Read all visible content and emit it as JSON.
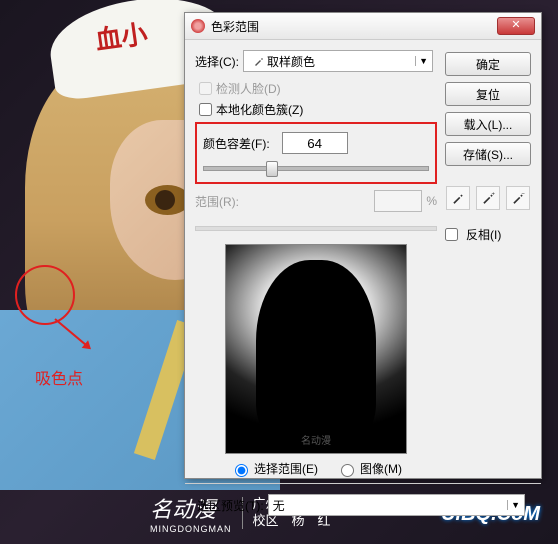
{
  "background": {
    "hat_text": "血小",
    "annotation": "吸色点",
    "logo_mark": "名动漫",
    "logo_sub": "MINGDONGMAN",
    "logo_line1": "广州　角　色",
    "logo_line2": "校区　杨　红",
    "watermark": "UiBQ.CoM"
  },
  "dialog": {
    "title": "色彩范围",
    "select_label": "选择(C):",
    "select_value": "取样颜色",
    "detect_faces": "检测人脸(D)",
    "localized": "本地化颜色簇(Z)",
    "fuzziness_label": "颜色容差(F):",
    "fuzziness_value": "64",
    "range_label": "范围(R):",
    "range_unit": "%",
    "radio_selection": "选择范围(E)",
    "radio_image": "图像(M)",
    "preview_wm": "名动漫",
    "footer_label": "选区预览(T):",
    "footer_value": "无"
  },
  "buttons": {
    "ok": "确定",
    "reset": "复位",
    "load": "载入(L)...",
    "save": "存储(S)...",
    "invert": "反相(I)"
  }
}
